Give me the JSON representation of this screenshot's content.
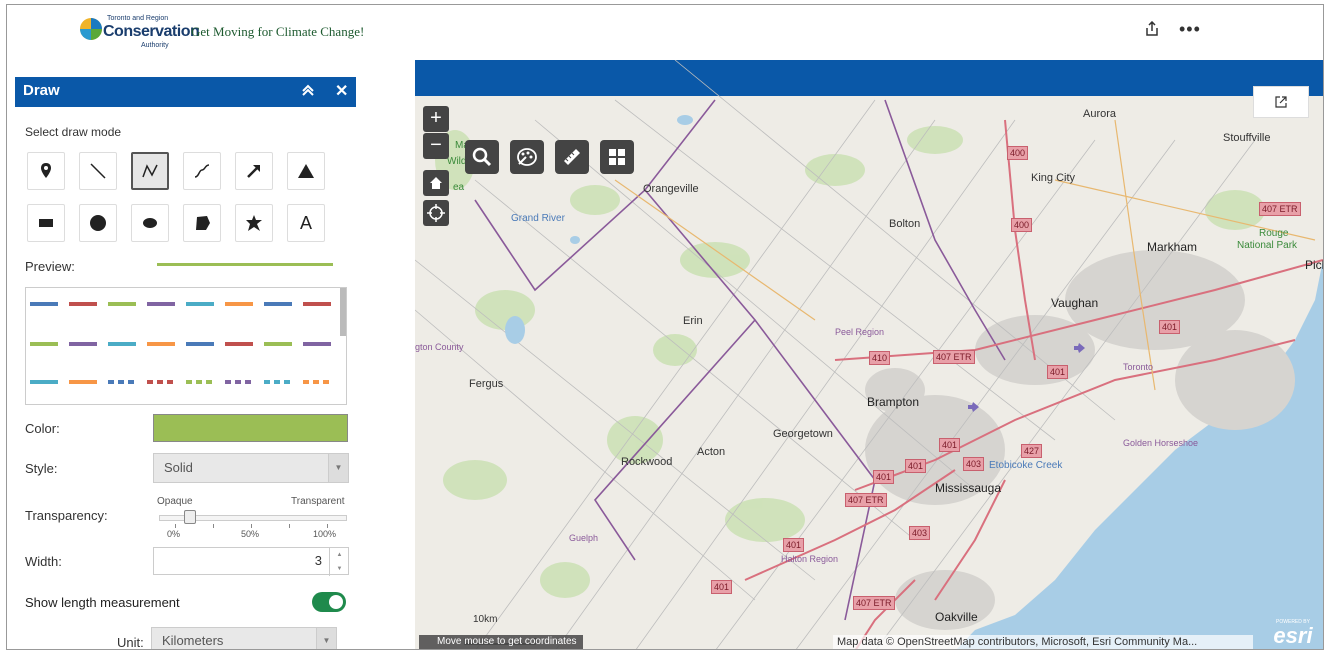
{
  "header": {
    "logo_line1": "Toronto and Region",
    "logo_line2": "Conservation",
    "logo_line3": "Authority",
    "app_title": "Get Moving for Climate Change!",
    "share_icon": "share-icon",
    "more_icon": "more-icon"
  },
  "panel": {
    "title": "Draw",
    "select_mode_label": "Select draw mode",
    "modes_row1": [
      "point",
      "line",
      "polyline",
      "freehand-polyline",
      "arrow",
      "triangle"
    ],
    "modes_row2": [
      "rectangle",
      "circle",
      "ellipse",
      "polygon",
      "freehand-polygon",
      "text"
    ],
    "text_mode_glyph": "A",
    "active_mode": "polyline",
    "preview_label": "Preview:",
    "preview_color": "#9bbe55",
    "color_label": "Color:",
    "color_value": "#9bbe55",
    "style_label": "Style:",
    "style_value": "Solid",
    "transparency_label": "Transparency:",
    "transparency_min": "Opaque",
    "transparency_max": "Transparent",
    "transparency_ticks": [
      "0%",
      "50%",
      "100%"
    ],
    "transparency_value": 0.1,
    "width_label": "Width:",
    "width_value": "3",
    "show_length_label": "Show length measurement",
    "show_length_on": true,
    "unit_label": "Unit:",
    "unit_value": "Kilometers",
    "swatch_rows": [
      [
        "#4a7ab8",
        "#c0504d",
        "#9bbe55",
        "#8064a2",
        "#4bacc6",
        "#f79646",
        "#4a7ab8",
        "#c0504d"
      ],
      [
        "#9bbe55",
        "#8064a2",
        "#4bacc6",
        "#f79646",
        "#4a7ab8",
        "#c0504d",
        "#9bbe55",
        "#8064a2"
      ],
      [
        "#4bacc6",
        "#f79646",
        "#4a7ab8",
        "#c0504d",
        "#9bbe55",
        "#8064a2",
        "#4bacc6",
        "#f79646"
      ]
    ]
  },
  "map": {
    "zoom_in": "+",
    "zoom_out": "−",
    "coords_text": "Move mouse to get coordinates",
    "attribution": "Map data © OpenStreetMap contributors, Microsoft, Esri Community Ma...",
    "esri_small": "POWERED BY",
    "esri_big": "esri",
    "scale_label": "10km",
    "places": {
      "aurora": "Aurora",
      "stouffville": "Stouffville",
      "king_city": "King City",
      "orangeville": "Orangeville",
      "bolton": "Bolton",
      "markham": "Markham",
      "rouge": "Rouge",
      "rouge2": "National Park",
      "pickering": "Pick",
      "vaughan": "Vaughan",
      "erin": "Erin",
      "peel": "Peel Region",
      "wellington": "gton County",
      "fergus": "Fergus",
      "brampton": "Brampton",
      "toronto": "Toronto",
      "georgetown": "Georgetown",
      "golden": "Golden Horseshoe",
      "rockwood": "Rockwood",
      "acton": "Acton",
      "etobicoke": "Etobicoke Creek",
      "mississauga": "Mississauga",
      "guelph": "Guelph",
      "halton": "Halton Region",
      "oakville": "Oakville",
      "grand_river": "Grand River",
      "ma": "Ma",
      "wildlife": "Wildlife",
      "ea": "ea"
    },
    "shields": {
      "s400a": "400",
      "s400b": "400",
      "s407a": "407 ETR",
      "s401a": "401",
      "s410": "410",
      "s407b": "407 ETR",
      "s401b": "401",
      "s401c": "401",
      "s427": "427",
      "s403a": "403",
      "s401d": "401",
      "s401e": "401",
      "s407c": "407 ETR",
      "s403b": "403",
      "s401f": "401",
      "s401g": "401",
      "s407d": "407 ETR"
    }
  }
}
